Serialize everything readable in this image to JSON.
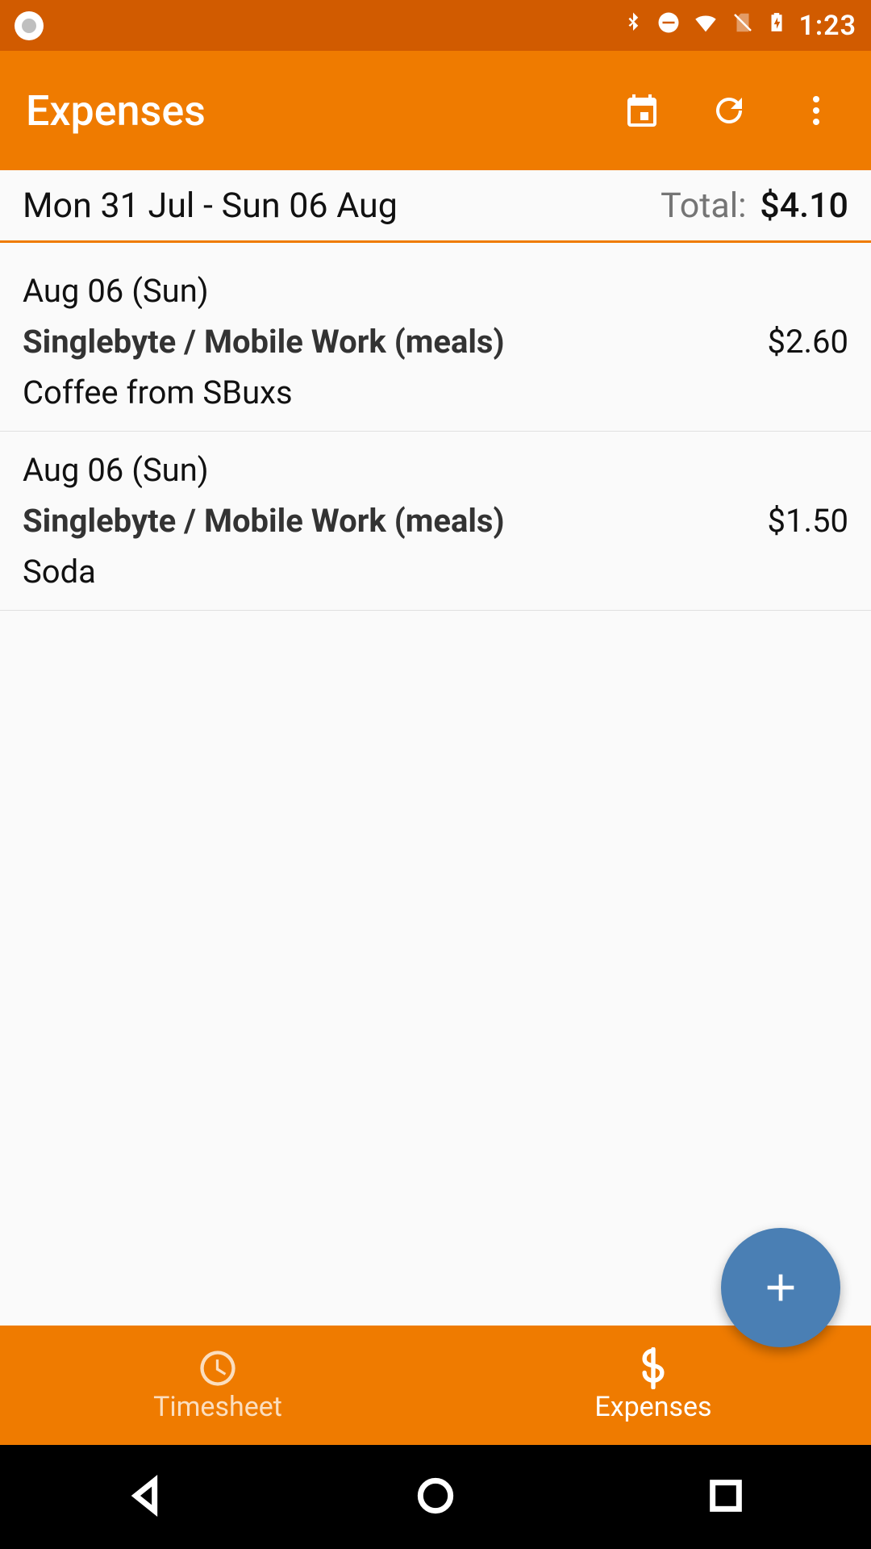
{
  "status": {
    "time": "1:23"
  },
  "appbar": {
    "title": "Expenses"
  },
  "summary": {
    "range": "Mon 31 Jul - Sun 06 Aug",
    "total_label": "Total:",
    "total_value": "$4.10"
  },
  "expenses": [
    {
      "date": "Aug 06 (Sun)",
      "category": "Singlebyte / Mobile Work (meals)",
      "amount": "$2.60",
      "description": "Coffee from SBuxs"
    },
    {
      "date": "Aug 06 (Sun)",
      "category": "Singlebyte / Mobile Work (meals)",
      "amount": "$1.50",
      "description": "Soda"
    }
  ],
  "nav": {
    "timesheet": "Timesheet",
    "expenses": "Expenses"
  }
}
